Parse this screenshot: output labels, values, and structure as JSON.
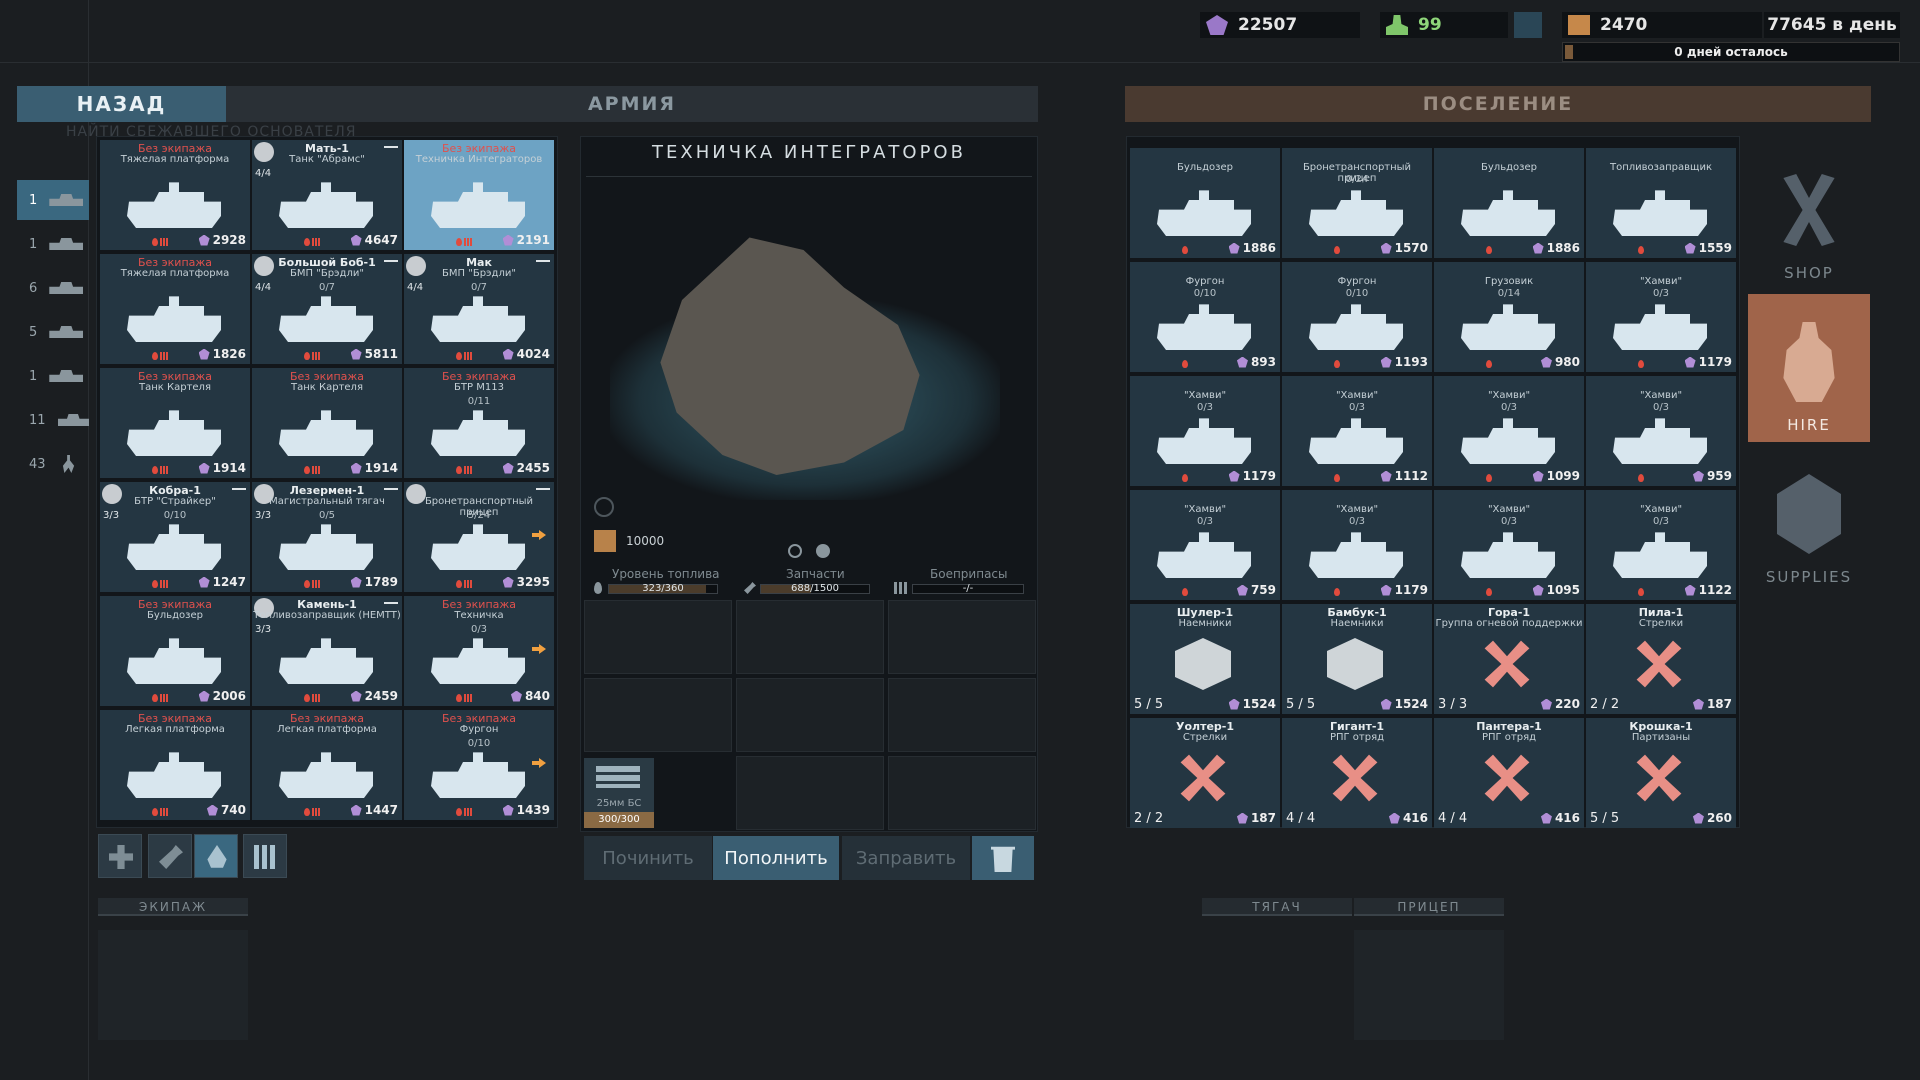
{
  "resources": {
    "gems": "22507",
    "people": "99",
    "crates": "2470",
    "income": "77645 в день",
    "days_left": "0 дней осталось"
  },
  "tabs": {
    "back": "НАЗАД",
    "army": "АРМИЯ",
    "settlement": "ПОСЕЛЕНИЕ"
  },
  "ghost_text": "НАЙТИ СБЕЖАВШЕГО ОСНОВАТЕЛЯ",
  "categories": [
    {
      "count": "1",
      "icon": "tank-icon"
    },
    {
      "count": "1",
      "icon": "apc-icon"
    },
    {
      "count": "6",
      "icon": "tank-icon"
    },
    {
      "count": "5",
      "icon": "apc-icon"
    },
    {
      "count": "1",
      "icon": "truck-icon"
    },
    {
      "count": "11",
      "icon": "car-icon"
    },
    {
      "count": "43",
      "icon": "soldier-icon"
    }
  ],
  "army_units": [
    {
      "status": "Без экипажа",
      "name": "",
      "type": "Тяжелая платформа",
      "value": "2928"
    },
    {
      "status": "",
      "name": "Мать-1",
      "type": "Танк \"Абрамс\"",
      "crew": "4/4",
      "value": "4647"
    },
    {
      "status": "Без экипажа",
      "name": "",
      "type": "Техничка Интеграторов",
      "value": "2191"
    },
    {
      "status": "Без экипажа",
      "name": "",
      "type": "Тяжелая платформа",
      "value": "1826"
    },
    {
      "status": "",
      "name": "Большой Боб-1",
      "type": "БМП \"Брэдли\"",
      "crew": "4/4",
      "cap": "0/7",
      "value": "5811"
    },
    {
      "status": "",
      "name": "Мак",
      "type": "БМП \"Брэдли\"",
      "crew": "4/4",
      "cap": "0/7",
      "value": "4024"
    },
    {
      "status": "Без экипажа",
      "name": "",
      "type": "Танк Картеля",
      "value": "1914"
    },
    {
      "status": "Без экипажа",
      "name": "",
      "type": "Танк Картеля",
      "value": "1914"
    },
    {
      "status": "Без экипажа",
      "name": "",
      "type": "БТР М113",
      "cap": "0/11",
      "value": "2455"
    },
    {
      "status": "",
      "name": "Кобра-1",
      "type": "БТР \"Страйкер\"",
      "crew": "3/3",
      "cap": "0/10",
      "value": "1247"
    },
    {
      "status": "",
      "name": "Лезермен-1",
      "type": "Магистральный тягач",
      "crew": "3/3",
      "cap": "0/5",
      "value": "1789"
    },
    {
      "status": "",
      "name": "",
      "type": "Бронетранспортный прицеп",
      "cap": "5/24",
      "value": "3295"
    },
    {
      "status": "Без экипажа",
      "name": "",
      "type": "Бульдозер",
      "value": "2006"
    },
    {
      "status": "",
      "name": "Камень-1",
      "type": "Топливозаправщик (HEMTT)",
      "crew": "3/3",
      "value": "2459"
    },
    {
      "status": "Без экипажа",
      "name": "",
      "type": "Техничка",
      "cap": "0/3",
      "value": "840"
    },
    {
      "status": "Без экипажа",
      "name": "",
      "type": "Легкая платформа",
      "value": "740"
    },
    {
      "status": "Без экипажа",
      "name": "",
      "type": "Легкая платформа",
      "value": "1447"
    },
    {
      "status": "Без экипажа",
      "name": "",
      "type": "Фургон",
      "cap": "0/10",
      "value": "1439"
    }
  ],
  "selected": {
    "title": "ТЕХНИЧКА ИНТЕГРАТОРОВ",
    "cargo": "10000",
    "fuel_label": "Уровень топлива",
    "fuel": "323/360",
    "fuel_frac": 0.9,
    "parts_label": "Запчасти",
    "parts": "688/1500",
    "parts_frac": 0.46,
    "ammo_label": "Боеприпасы",
    "ammo": "-/-",
    "ammo_item": "25мм БС",
    "ammo_count": "300/300"
  },
  "actions": {
    "repair": "Починить",
    "resupply": "Пополнить",
    "refuel": "Заправить"
  },
  "settlement_units": [
    {
      "type": "Бульдозер",
      "cap": "",
      "value": "1886"
    },
    {
      "type": "Бронетранспортный прицеп",
      "cap": "0/24",
      "value": "1570"
    },
    {
      "type": "Бульдозер",
      "cap": "",
      "value": "1886"
    },
    {
      "type": "Топливозаправщик",
      "cap": "",
      "value": "1559"
    },
    {
      "type": "Фургон",
      "cap": "0/10",
      "value": "893"
    },
    {
      "type": "Фургон",
      "cap": "0/10",
      "value": "1193"
    },
    {
      "type": "Грузовик",
      "cap": "0/14",
      "value": "980"
    },
    {
      "type": "\"Хамви\"",
      "cap": "0/3",
      "value": "1179"
    },
    {
      "type": "\"Хамви\"",
      "cap": "0/3",
      "value": "1179"
    },
    {
      "type": "\"Хамви\"",
      "cap": "0/3",
      "value": "1112"
    },
    {
      "type": "\"Хамви\"",
      "cap": "0/3",
      "value": "1099"
    },
    {
      "type": "\"Хамви\"",
      "cap": "0/3",
      "value": "959"
    },
    {
      "type": "\"Хамви\"",
      "cap": "0/3",
      "value": "759"
    },
    {
      "type": "\"Хамви\"",
      "cap": "0/3",
      "value": "1179"
    },
    {
      "type": "\"Хамви\"",
      "cap": "0/3",
      "value": "1095"
    },
    {
      "type": "\"Хамви\"",
      "cap": "0/3",
      "value": "1122"
    },
    {
      "name": "Шулер-1",
      "type": "Наемники",
      "count": "5 / 5",
      "value": "1524",
      "icon": "hex"
    },
    {
      "name": "Бамбук-1",
      "type": "Наемники",
      "count": "5 / 5",
      "value": "1524",
      "icon": "hex"
    },
    {
      "name": "Гора-1",
      "type": "Группа огневой поддержки",
      "count": "3 / 3",
      "value": "220",
      "icon": "x"
    },
    {
      "name": "Пила-1",
      "type": "Стрелки",
      "count": "2 / 2",
      "value": "187",
      "icon": "x"
    },
    {
      "name": "Уолтер-1",
      "type": "Стрелки",
      "count": "2 / 2",
      "value": "187",
      "icon": "x"
    },
    {
      "name": "Гигант-1",
      "type": "РПГ отряд",
      "count": "4 / 4",
      "value": "416",
      "icon": "x"
    },
    {
      "name": "Пантера-1",
      "type": "РПГ отряд",
      "count": "4 / 4",
      "value": "416",
      "icon": "x"
    },
    {
      "name": "Крошка-1",
      "type": "Партизаны",
      "count": "5 / 5",
      "value": "260",
      "icon": "x"
    }
  ],
  "menu": {
    "shop": "SHOP",
    "hire": "HIRE",
    "supplies": "SUPPLIES"
  },
  "bottom": {
    "crew": "ЭКИПАЖ",
    "tractor": "ТЯГАЧ",
    "trailer": "ПРИЦЕП"
  },
  "colors": {
    "accent": "#3a5e72",
    "settlement": "#a0644a",
    "no_crew": "#e0514d"
  }
}
